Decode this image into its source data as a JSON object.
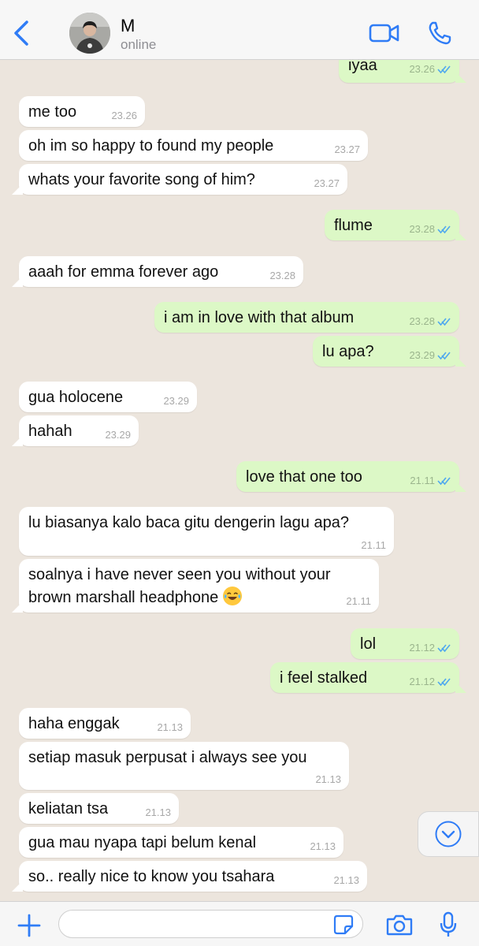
{
  "contact": {
    "name": "M",
    "status": "online"
  },
  "input": {
    "placeholder": ""
  },
  "messages": [
    {
      "dir": "out",
      "text": "iyaa",
      "time": "23.26"
    },
    {
      "dir": "in",
      "text": "me too",
      "time": "23.26"
    },
    {
      "dir": "in",
      "text": "oh im so happy to found my people",
      "time": "23.27"
    },
    {
      "dir": "in",
      "text": "whats your favorite song of him?",
      "time": "23.27"
    },
    {
      "dir": "out",
      "text": "flume",
      "time": "23.28"
    },
    {
      "dir": "in",
      "text": "aaah for emma forever ago",
      "time": "23.28"
    },
    {
      "dir": "out",
      "text": "i am in love with that album",
      "time": "23.28"
    },
    {
      "dir": "out",
      "text": "lu apa?",
      "time": "23.29"
    },
    {
      "dir": "in",
      "text": "gua holocene",
      "time": "23.29"
    },
    {
      "dir": "in",
      "text": "hahah",
      "time": "23.29"
    },
    {
      "dir": "out",
      "text": "love that one too",
      "time": "21.11"
    },
    {
      "dir": "in",
      "text": "lu biasanya kalo baca gitu dengerin lagu apa?",
      "time": "21.11"
    },
    {
      "dir": "in",
      "line1": "soalnya i have never seen you without your",
      "line2": "brown marshall headphone",
      "emoji": "face-with-tears-of-joy",
      "time": "21.11"
    },
    {
      "dir": "out",
      "text": "lol",
      "time": "21.12"
    },
    {
      "dir": "out",
      "text": "i feel stalked",
      "time": "21.12"
    },
    {
      "dir": "in",
      "text": "haha enggak",
      "time": "21.13"
    },
    {
      "dir": "in",
      "text": "setiap masuk perpusat i always see you",
      "time": "21.13"
    },
    {
      "dir": "in",
      "text": "keliatan tsa",
      "time": "21.13"
    },
    {
      "dir": "in",
      "text": "gua mau nyapa tapi belum kenal",
      "time": "21.13"
    },
    {
      "dir": "in",
      "text": "so.. really nice to know you tsahara",
      "time": "21.13"
    }
  ],
  "colors": {
    "accent": "#2f7cf6",
    "incoming": "#ffffff",
    "outgoing": "#dcf8c6",
    "background": "#ece5dd",
    "read_ticks": "#4fa8ee"
  },
  "icons": [
    "back-chevron-icon",
    "video-call-icon",
    "phone-icon",
    "chevron-down-icon",
    "plus-icon",
    "sticker-icon",
    "camera-icon",
    "microphone-icon"
  ]
}
